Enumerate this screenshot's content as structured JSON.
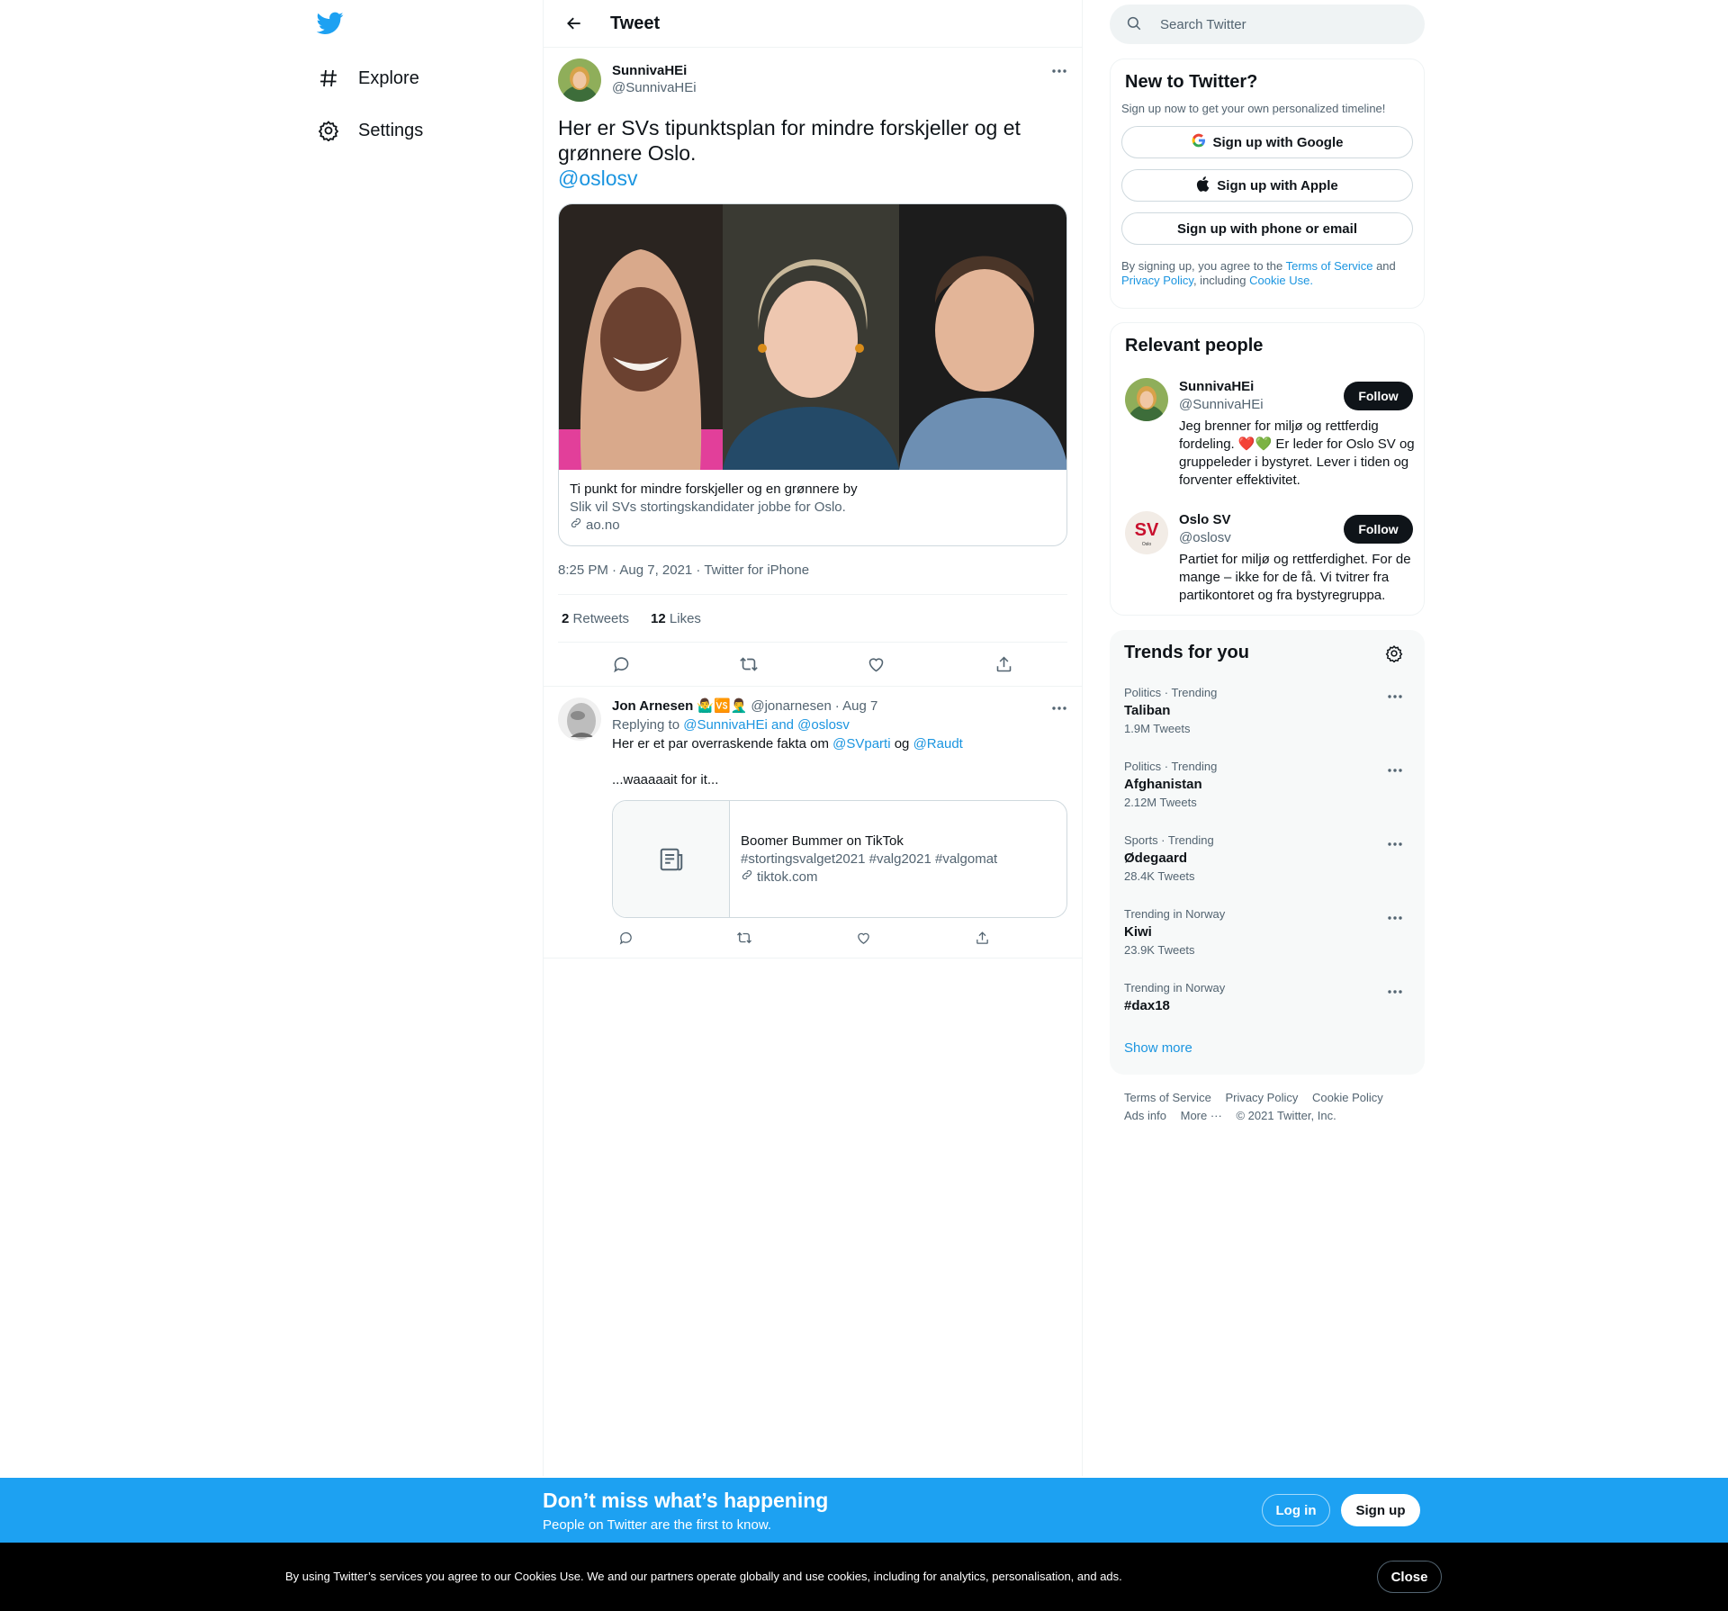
{
  "colors": {
    "accent": "#1da1f2",
    "link": "#1b95e0",
    "text": "#0f1419",
    "muted": "#536471"
  },
  "nav": {
    "logo_icon": "twitter-bird-icon",
    "items": [
      {
        "label": "Explore",
        "icon": "hashtag-icon"
      },
      {
        "label": "Settings",
        "icon": "gear-icon"
      }
    ]
  },
  "header": {
    "title": "Tweet"
  },
  "tweet": {
    "author_name": "SunnivaHEi",
    "author_handle": "@SunnivaHEi",
    "text": "Her er SVs tipunktsplan for mindre forskjeller og et grønnere Oslo.",
    "mention": "@oslosv",
    "card": {
      "title": "Ti punkt for mindre forskjeller og en grønnere by",
      "description": "Slik vil SVs stortingskandidater jobbe for Oslo.",
      "domain": "ao.no"
    },
    "meta": "8:25 PM · Aug 7, 2021 · Twitter for iPhone",
    "retweets": {
      "count": "2",
      "label": "Retweets"
    },
    "likes": {
      "count": "12",
      "label": "Likes"
    }
  },
  "reply": {
    "author_name": "Jon Arnesen",
    "emojis": "🤷‍♂️🆚🤦‍♂️",
    "handle": "@jonarnesen",
    "date": "· Aug 7",
    "replying_to_label": "Replying to",
    "replying_to_targets": "@SunnivaHEi and @oslosv",
    "text_before": "Her er et par overraskende fakta om",
    "mention1": "@SVparti",
    "text_mid": "og",
    "mention2": "@Raudt",
    "text2": "...waaaaait for it...",
    "card": {
      "title": "Boomer Bummer on TikTok",
      "description": "#stortingsvalget2021 #valg2021 #valgomat",
      "domain": "tiktok.com"
    }
  },
  "search": {
    "placeholder": "Search Twitter"
  },
  "signup_panel": {
    "title": "New to Twitter?",
    "subtitle": "Sign up now to get your own personalized timeline!",
    "google": "Sign up with Google",
    "apple": "Sign up with Apple",
    "phone": "Sign up with phone or email",
    "legal_prefix": "By signing up, you agree to the",
    "terms": "Terms of Service",
    "and": "and",
    "privacy": "Privacy Policy",
    "including": ", including",
    "cookie": "Cookie Use."
  },
  "people_panel": {
    "title": "Relevant people",
    "people": [
      {
        "name": "SunnivaHEi",
        "handle": "@SunnivaHEi",
        "follow": "Follow",
        "bio": "Jeg brenner for miljø og rettferdig fordeling. ❤️💚 Er leder for Oslo SV og gruppeleder i bystyret. Lever i tiden og forventer effektivitet."
      },
      {
        "name": "Oslo SV",
        "handle": "@oslosv",
        "follow": "Follow",
        "bio": "Partiet for miljø og rettferdighet. For de mange – ikke for de få. Vi tvitrer fra partikontoret og fra bystyregruppa.",
        "logo_text": "SV",
        "logo_sub": "Oslo"
      }
    ]
  },
  "trends_panel": {
    "title": "Trends for you",
    "trends": [
      {
        "context": "Politics · Trending",
        "name": "Taliban",
        "count": "1.9M Tweets"
      },
      {
        "context": "Politics · Trending",
        "name": "Afghanistan",
        "count": "2.12M Tweets"
      },
      {
        "context": "Sports · Trending",
        "name": "Ødegaard",
        "count": "28.4K Tweets"
      },
      {
        "context": "Trending in Norway",
        "name": "Kiwi",
        "count": "23.9K Tweets"
      },
      {
        "context": "Trending in Norway",
        "name": "#dax18",
        "count": ""
      }
    ],
    "show_more": "Show more"
  },
  "footer": {
    "terms": "Terms of Service",
    "privacy": "Privacy Policy",
    "cookie": "Cookie Policy",
    "ads": "Ads info",
    "more": "More ···",
    "copyright": "© 2021 Twitter, Inc."
  },
  "signup_bar": {
    "title": "Don’t miss what’s happening",
    "subtitle": "People on Twitter are the first to know.",
    "login": "Log in",
    "signup": "Sign up"
  },
  "cookie_bar": {
    "text": "By using Twitter’s services you agree to our Cookies Use. We and our partners operate globally and use cookies, including for analytics, personalisation, and ads.",
    "close": "Close"
  }
}
